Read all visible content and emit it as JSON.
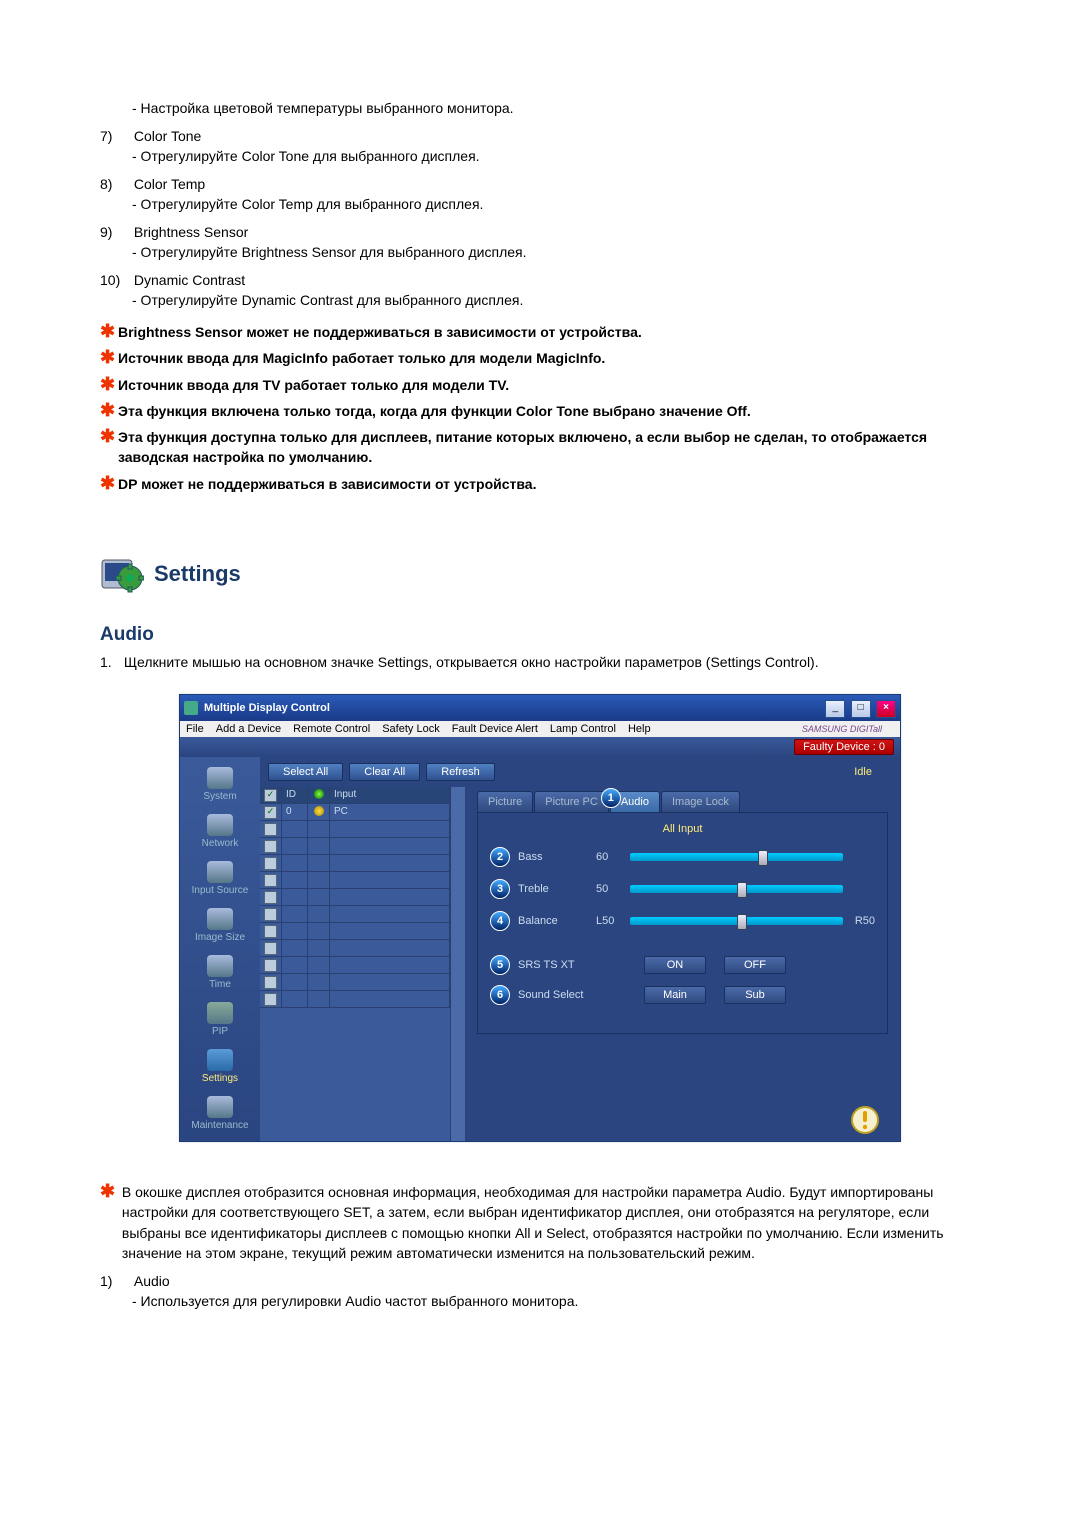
{
  "top": {
    "desc0": "- Настройка цветовой температуры выбранного монитора.",
    "items": [
      {
        "num": "7)",
        "label": "Color Tone",
        "desc": "- Отрегулируйте Color Tone для выбранного дисплея."
      },
      {
        "num": "8)",
        "label": "Color Temp",
        "desc": "- Отрегулируйте Color Temp для выбранного дисплея."
      },
      {
        "num": "9)",
        "label": "Brightness Sensor",
        "desc": "- Отрегулируйте Brightness Sensor для выбранного дисплея."
      },
      {
        "num": "10)",
        "label": "Dynamic Contrast",
        "desc": "- Отрегулируйте Dynamic Contrast для выбранного дисплея."
      }
    ],
    "notes": [
      "Brightness Sensor может не поддерживаться в зависимости от устройства.",
      "Источник ввода для MagicInfo работает только для модели MagicInfo.",
      "Источник ввода для TV работает только для модели TV.",
      "Эта функция включена только тогда, когда для функции Color Tone выбрано значение Off.",
      "Эта функция доступна только для дисплеев, питание которых включено, а если выбор не сделан, то отображается заводская настройка по умолчанию.",
      "DP может не поддерживаться в зависимости от устройства."
    ]
  },
  "section": {
    "title": "Settings",
    "subtitle": "Audio",
    "intro_num": "1.",
    "intro": "Щелкните мышью на основном значке Settings, открывается окно настройки параметров (Settings Control)."
  },
  "window": {
    "title": "Multiple Display Control",
    "menu": [
      "File",
      "Add a Device",
      "Remote Control",
      "Safety Lock",
      "Fault Device Alert",
      "Lamp Control",
      "Help"
    ],
    "logo": "SAMSUNG DIGITall",
    "fault": "Faulty Device : 0",
    "toolbar": {
      "selectall": "Select All",
      "clearall": "Clear All",
      "refresh": "Refresh",
      "idle": "Idle"
    },
    "sidebar": [
      "System",
      "Network",
      "Input Source",
      "Image Size",
      "Time",
      "PIP",
      "Settings",
      "Maintenance"
    ],
    "grid": {
      "headers": {
        "id": "ID",
        "input": "Input"
      },
      "row1": {
        "id": "0",
        "input": "PC"
      }
    },
    "tabs": {
      "picture": "Picture",
      "picturepc": "Picture PC",
      "audio": "Audio",
      "imagelock": "Image Lock",
      "callout": "1"
    },
    "panel": {
      "title": "All Input",
      "bass": {
        "num": "2",
        "label": "Bass",
        "val": "60"
      },
      "treble": {
        "num": "3",
        "label": "Treble",
        "val": "50"
      },
      "balance": {
        "num": "4",
        "label": "Balance",
        "val": "L50",
        "end": "R50"
      },
      "srs": {
        "num": "5",
        "label": "SRS TS XT",
        "on": "ON",
        "off": "OFF"
      },
      "sound": {
        "num": "6",
        "label": "Sound Select",
        "main": "Main",
        "sub": "Sub"
      }
    }
  },
  "bottom": {
    "note": "В окошке дисплея отобразится основная информация, необходимая для настройки параметра Audio. Будут импортированы настройки для соответствующего SET, а затем, если выбран идентификатор дисплея, они отобразятся на регуляторе, если выбраны все идентификаторы дисплеев с помощью кнопки All и Select, отобразятся настройки по умолчанию. Если изменить значение на этом экране, текущий режим автоматически изменится на пользовательский режим.",
    "item1_num": "1)",
    "item1_label": "Audio",
    "item1_desc": "- Используется для регулировки Audio частот выбранного монитора."
  }
}
